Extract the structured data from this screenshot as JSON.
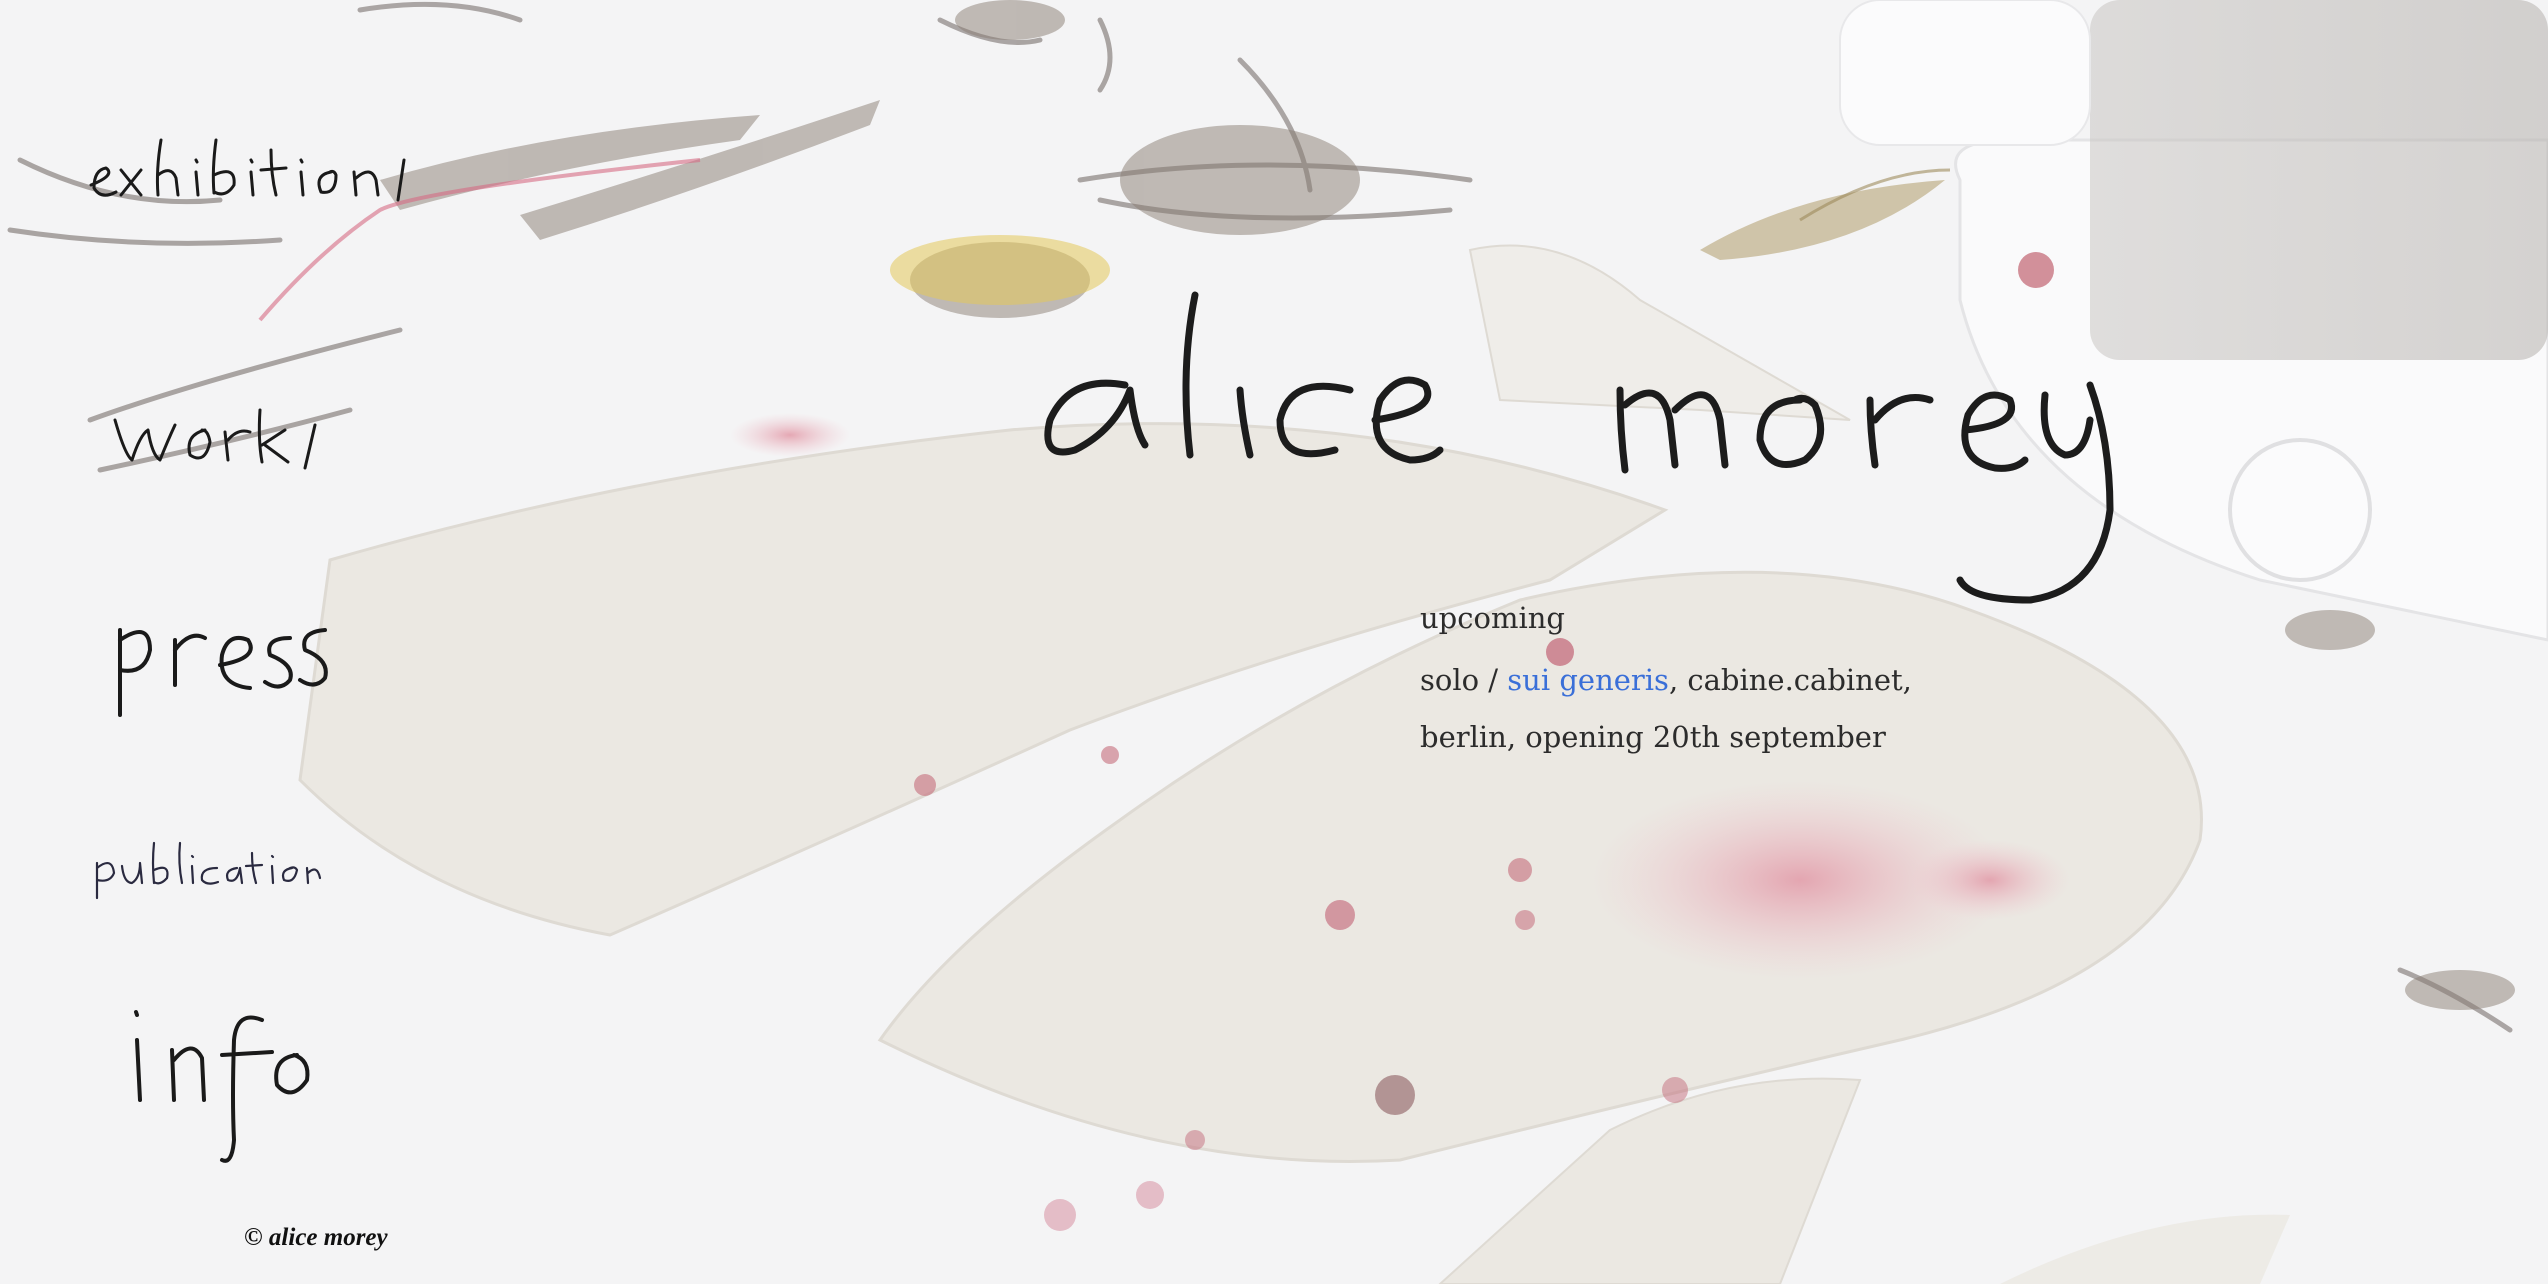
{
  "site": {
    "title": "alice morey"
  },
  "nav": {
    "items": [
      {
        "label": "exhibitions"
      },
      {
        "label": "works"
      },
      {
        "label": "press"
      },
      {
        "label": "publications"
      },
      {
        "label": "info"
      }
    ]
  },
  "announcement": {
    "heading": "upcoming",
    "prefix": "solo / ",
    "link_text": "sui generis",
    "suffix": ", cabine.cabinet,",
    "line2": "berlin, opening 20th september"
  },
  "footer": {
    "copyright": "© alice morey"
  },
  "colors": {
    "background": "#f4f4f5",
    "text": "#2c2c2c",
    "link": "#3a6fd8",
    "handwriting": "#1a1a1a"
  }
}
